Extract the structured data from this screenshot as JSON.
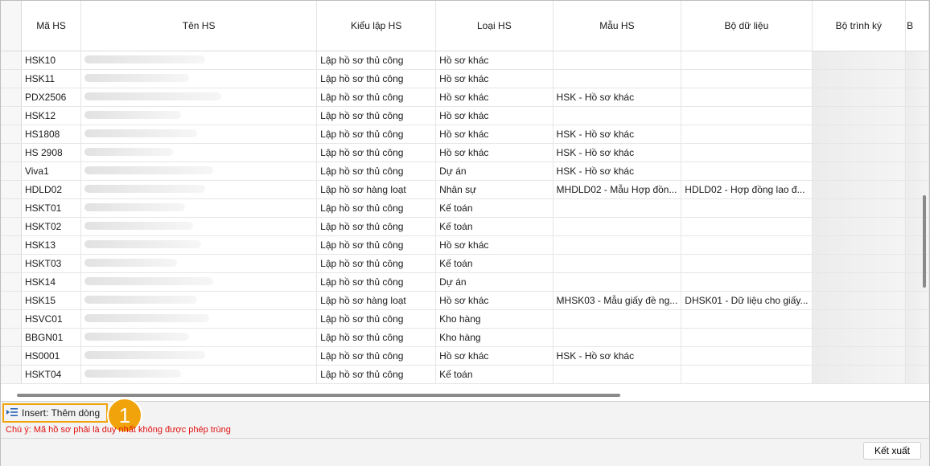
{
  "columns": [
    "Mã HS",
    "Tên HS",
    "Kiểu lập HS",
    "Loại HS",
    "Mẫu HS",
    "Bộ dữ liệu",
    "Bộ trình ký",
    "B"
  ],
  "rows": [
    {
      "ma": "HSK10",
      "kieu": "Lập hồ sơ thủ công",
      "loai": "Hồ sơ khác",
      "mau": "",
      "bo": ""
    },
    {
      "ma": "HSK11",
      "kieu": "Lập hồ sơ thủ công",
      "loai": "Hồ sơ khác",
      "mau": "",
      "bo": ""
    },
    {
      "ma": "PDX2506",
      "kieu": "Lập hồ sơ thủ công",
      "loai": "Hồ sơ khác",
      "mau": "HSK - Hồ sơ khác",
      "bo": ""
    },
    {
      "ma": "HSK12",
      "kieu": "Lập hồ sơ thủ công",
      "loai": "Hồ sơ khác",
      "mau": "",
      "bo": ""
    },
    {
      "ma": "HS1808",
      "kieu": "Lập hồ sơ thủ công",
      "loai": "Hồ sơ khác",
      "mau": "HSK - Hồ sơ khác",
      "bo": ""
    },
    {
      "ma": "HS 2908",
      "kieu": "Lập hồ sơ thủ công",
      "loai": "Hồ sơ khác",
      "mau": "HSK - Hồ sơ khác",
      "bo": ""
    },
    {
      "ma": "Viva1",
      "kieu": "Lập hồ sơ thủ công",
      "loai": "Dự án",
      "mau": "HSK - Hồ sơ khác",
      "bo": ""
    },
    {
      "ma": "HDLD02",
      "kieu": "Lập hồ sơ hàng loạt",
      "loai": "Nhân sự",
      "mau": "MHDLD02 - Mẫu Hợp đồn...",
      "bo": "HDLD02 - Hợp đồng lao đ..."
    },
    {
      "ma": "HSKT01",
      "kieu": "Lập hồ sơ thủ công",
      "loai": "Kế toán",
      "mau": "",
      "bo": ""
    },
    {
      "ma": "HSKT02",
      "kieu": "Lập hồ sơ thủ công",
      "loai": "Kế toán",
      "mau": "",
      "bo": ""
    },
    {
      "ma": "HSK13",
      "kieu": "Lập hồ sơ thủ công",
      "loai": "Hồ sơ khác",
      "mau": "",
      "bo": ""
    },
    {
      "ma": "HSKT03",
      "kieu": "Lập hồ sơ thủ công",
      "loai": "Kế toán",
      "mau": "",
      "bo": ""
    },
    {
      "ma": "HSK14",
      "kieu": "Lập hồ sơ thủ công",
      "loai": "Dự án",
      "mau": "",
      "bo": ""
    },
    {
      "ma": "HSK15",
      "kieu": "Lập hồ sơ hàng loạt",
      "loai": "Hồ sơ khác",
      "mau": "MHSK03 - Mẫu giấy đề ng...",
      "bo": "DHSK01 - Dữ liệu cho giấy..."
    },
    {
      "ma": "HSVC01",
      "kieu": "Lập hồ sơ thủ công",
      "loai": "Kho hàng",
      "mau": "",
      "bo": ""
    },
    {
      "ma": "BBGN01",
      "kieu": "Lập hồ sơ thủ công",
      "loai": "Kho hàng",
      "mau": "",
      "bo": ""
    },
    {
      "ma": "HS0001",
      "kieu": "Lập hồ sơ thủ công",
      "loai": "Hồ sơ khác",
      "mau": "HSK - Hồ sơ khác",
      "bo": ""
    },
    {
      "ma": "HSKT04",
      "kieu": "Lập hồ sơ thủ công",
      "loai": "Kế toán",
      "mau": "",
      "bo": ""
    }
  ],
  "toolbar": {
    "insert_label": "Insert: Thêm dòng",
    "badge": "1"
  },
  "note": "Chú ý: Mã hồ sơ phải là duy nhất không được phép trùng",
  "export_label": "Kết xuất",
  "colors": {
    "accent": "#f0a30a",
    "note": "#e01010"
  }
}
